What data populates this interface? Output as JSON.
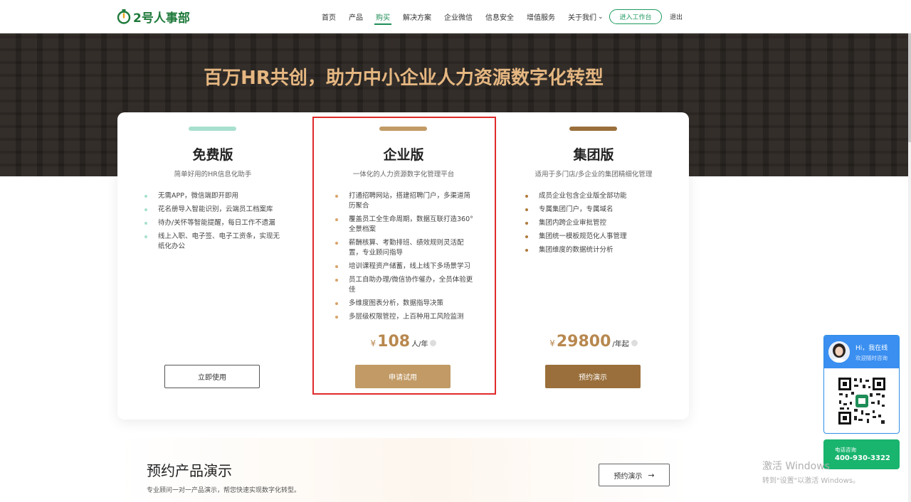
{
  "brand": {
    "name": "2号人事部",
    "color": "#1f7a3b"
  },
  "nav": {
    "items": [
      {
        "label": "首页"
      },
      {
        "label": "产品"
      },
      {
        "label": "购买",
        "active": true
      },
      {
        "label": "解决方案"
      },
      {
        "label": "企业微信"
      },
      {
        "label": "信息安全"
      },
      {
        "label": "增值服务"
      },
      {
        "label": "关于我们"
      }
    ],
    "enter_label": "进入工作台",
    "logout_label": "退出"
  },
  "hero": {
    "title": "百万HR共创，助力中小企业人力资源数字化转型"
  },
  "plans": [
    {
      "name": "免费版",
      "subtitle": "简单好用的HR信息化助手",
      "accent": "#a8e0cf",
      "features": [
        "无需APP，微信端即开即用",
        "花名册导入智能识别，云端员工档案库",
        "待办/关怀等智能提醒，每日工作不遗漏",
        "线上入职、电子签、电子工资条，实现无纸化办公"
      ],
      "button": "立即使用"
    },
    {
      "name": "企业版",
      "subtitle": "一体化的人力资源数字化管理平台",
      "accent": "#c19a65",
      "features": [
        "打通招聘网站，搭建招聘门户，多渠道简历聚合",
        "覆盖员工全生命周期，数据互联打造360°全景档案",
        "薪酬核算、考勤排班、绩效规则灵活配置，专业顾问指导",
        "培训课程资产储蓄，线上线下多场景学习",
        "员工自助办理/微信协作催办，全员体验更佳",
        "多维度图表分析，数据指导决策",
        "多层级权限管控，上百种用工风险监测"
      ],
      "price": {
        "currency": "¥",
        "amount": "108",
        "unit": "人/年"
      },
      "button": "申请试用"
    },
    {
      "name": "集团版",
      "subtitle": "适用于多门店/多企业的集团精细化管理",
      "accent": "#9a6f3b",
      "features": [
        "成员企业包含企业版全部功能",
        "专属集团门户，专属域名",
        "集团内跨企业审批管控",
        "集团统一模板规范化人事管理",
        "集团维度的数据统计分析"
      ],
      "price": {
        "currency": "¥",
        "amount": "29800",
        "unit": "/年起"
      },
      "button": "预约演示"
    }
  ],
  "demo": {
    "title": "预约产品演示",
    "desc": "专业顾问一对一产品演示，帮您快速实现数字化转型。",
    "button": "预约演示",
    "arrow": "→"
  },
  "chat": {
    "title": "Hi，我在线",
    "subtitle": "欢迎随时咨询"
  },
  "phone": {
    "label": "电话咨询",
    "number": "400-930-3322"
  },
  "watermark": {
    "line1": "激活 Windows",
    "line2": "转到\"设置\"以激活 Windows。"
  }
}
